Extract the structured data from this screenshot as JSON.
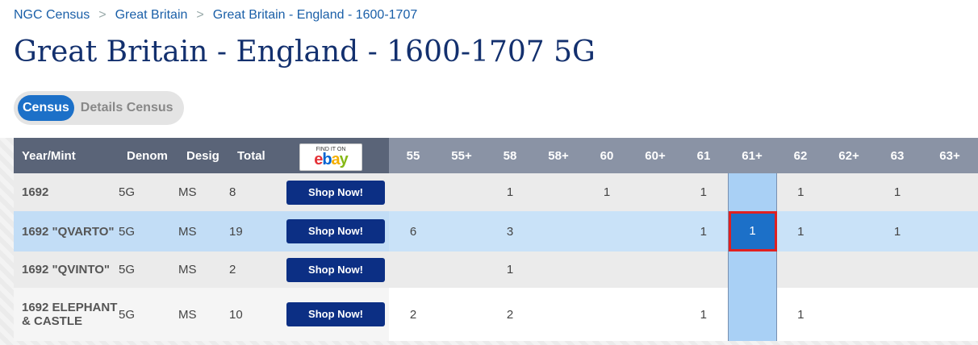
{
  "breadcrumb": [
    "NGC Census",
    "Great Britain",
    "Great Britain - England - 1600-1707"
  ],
  "title": "Great Britain - England - 1600-1707 5G",
  "tabs": {
    "active": "Census",
    "inactive": "Details Census"
  },
  "ebay": {
    "find_text": "FIND IT ON",
    "logo": [
      "e",
      "b",
      "a",
      "y"
    ]
  },
  "columns": {
    "left": [
      "Year/Mint",
      "Denom",
      "Desig",
      "Total"
    ],
    "grades": [
      "55",
      "55+",
      "58",
      "58+",
      "60",
      "60+",
      "61",
      "61+",
      "62",
      "62+",
      "63",
      "63+"
    ]
  },
  "shop_label": "Shop Now!",
  "rows": [
    {
      "year": "1692",
      "denom": "5G",
      "desig": "MS",
      "total": "8",
      "grades": [
        "",
        "",
        "1",
        "",
        "1",
        "",
        "1",
        "",
        "1",
        "",
        "1",
        ""
      ]
    },
    {
      "year": "1692 \"QVARTO\"",
      "denom": "5G",
      "desig": "MS",
      "total": "19",
      "grades": [
        "6",
        "",
        "3",
        "",
        "",
        "",
        "1",
        "1",
        "1",
        "",
        "1",
        ""
      ]
    },
    {
      "year": "1692 \"QVINTO\"",
      "denom": "5G",
      "desig": "MS",
      "total": "2",
      "grades": [
        "",
        "",
        "1",
        "",
        "",
        "",
        "",
        "",
        "",
        "",
        "",
        ""
      ]
    },
    {
      "year": "1692 ELEPHANT & CASTLE",
      "denom": "5G",
      "desig": "MS",
      "total": "10",
      "grades": [
        "2",
        "",
        "2",
        "",
        "",
        "",
        "1",
        "",
        "1",
        "",
        "",
        ""
      ]
    }
  ],
  "colors": {
    "accent": "#1c70c8",
    "title": "#13306e",
    "focus_border": "#e02020",
    "shop_button": "#0c2f84"
  }
}
